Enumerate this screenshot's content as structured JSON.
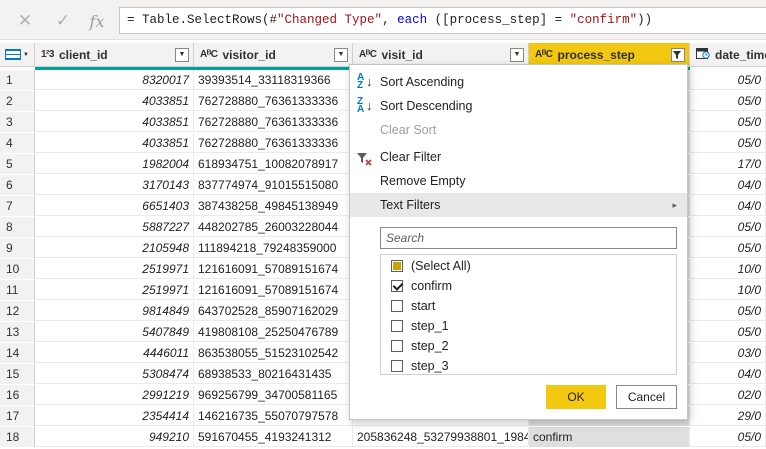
{
  "formula_bar": {
    "cancel_icon": "✕",
    "commit_icon": "✓",
    "fx_label": "fx",
    "formula_pre": "= Table.SelectRows(#",
    "formula_str1": "\"Changed Type\"",
    "formula_mid1": ", ",
    "formula_kw": "each",
    "formula_mid2": " ([process_step] = ",
    "formula_str2": "\"confirm\"",
    "formula_post": "))"
  },
  "columns": [
    {
      "type_icon": "1²3",
      "name": "client_id"
    },
    {
      "type_icon": "AᴮC",
      "name": "visitor_id"
    },
    {
      "type_icon": "AᴮC",
      "name": "visit_id"
    },
    {
      "type_icon": "AᴮC",
      "name": "process_step"
    },
    {
      "type_icon": "📅",
      "name": "date_time"
    }
  ],
  "rows": [
    {
      "n": "1",
      "client_id": "8320017",
      "visitor_id": "39393514_33118319366",
      "visit_id": "",
      "process_step": "",
      "date_time": "05/0"
    },
    {
      "n": "2",
      "client_id": "4033851",
      "visitor_id": "762728880_76361333336",
      "visit_id": "",
      "process_step": "",
      "date_time": "05/0"
    },
    {
      "n": "3",
      "client_id": "4033851",
      "visitor_id": "762728880_76361333336",
      "visit_id": "",
      "process_step": "",
      "date_time": "05/0"
    },
    {
      "n": "4",
      "client_id": "4033851",
      "visitor_id": "762728880_76361333336",
      "visit_id": "",
      "process_step": "",
      "date_time": "05/0"
    },
    {
      "n": "5",
      "client_id": "1982004",
      "visitor_id": "618934751_10082078917",
      "visit_id": "",
      "process_step": "",
      "date_time": "17/0"
    },
    {
      "n": "6",
      "client_id": "3170143",
      "visitor_id": "837774974_91015515080",
      "visit_id": "",
      "process_step": "",
      "date_time": "04/0"
    },
    {
      "n": "7",
      "client_id": "6651403",
      "visitor_id": "387438258_49845138949",
      "visit_id": "",
      "process_step": "",
      "date_time": "04/0"
    },
    {
      "n": "8",
      "client_id": "5887227",
      "visitor_id": "448202785_26003228044",
      "visit_id": "",
      "process_step": "",
      "date_time": "05/0"
    },
    {
      "n": "9",
      "client_id": "2105948",
      "visitor_id": "111894218_79248359000",
      "visit_id": "",
      "process_step": "",
      "date_time": "05/0"
    },
    {
      "n": "10",
      "client_id": "2519971",
      "visitor_id": "121616091_57089151674",
      "visit_id": "",
      "process_step": "",
      "date_time": "10/0"
    },
    {
      "n": "11",
      "client_id": "2519971",
      "visitor_id": "121616091_57089151674",
      "visit_id": "",
      "process_step": "",
      "date_time": "10/0"
    },
    {
      "n": "12",
      "client_id": "9814849",
      "visitor_id": "643702528_85907162029",
      "visit_id": "",
      "process_step": "",
      "date_time": "05/0"
    },
    {
      "n": "13",
      "client_id": "5407849",
      "visitor_id": "419808108_25250476789",
      "visit_id": "",
      "process_step": "",
      "date_time": "05/0"
    },
    {
      "n": "14",
      "client_id": "4446011",
      "visitor_id": "863538055_51523102542",
      "visit_id": "",
      "process_step": "",
      "date_time": "03/0"
    },
    {
      "n": "15",
      "client_id": "5308474",
      "visitor_id": "68938533_80216431435",
      "visit_id": "",
      "process_step": "",
      "date_time": "04/0"
    },
    {
      "n": "16",
      "client_id": "2991219",
      "visitor_id": "969256799_34700581165",
      "visit_id": "",
      "process_step": "",
      "date_time": "02/0"
    },
    {
      "n": "17",
      "client_id": "2354414",
      "visitor_id": "146216735_55070797578",
      "visit_id": "",
      "process_step": "confirm",
      "date_time": "29/0"
    },
    {
      "n": "18",
      "client_id": "949210",
      "visitor_id": "591670455_4193241312",
      "visit_id": "205836248_53279938801_1984...",
      "process_step": "confirm",
      "date_time": "05/0"
    }
  ],
  "menu": {
    "sort_asc": "Sort Ascending",
    "sort_desc": "Sort Descending",
    "clear_sort": "Clear Sort",
    "clear_filter": "Clear Filter",
    "remove_empty": "Remove Empty",
    "text_filters": "Text Filters",
    "search_placeholder": "Search",
    "values": [
      {
        "label": "(Select All)",
        "state": "partial"
      },
      {
        "label": "confirm",
        "state": "checked"
      },
      {
        "label": "start",
        "state": "unchecked"
      },
      {
        "label": "step_1",
        "state": "unchecked"
      },
      {
        "label": "step_2",
        "state": "unchecked"
      },
      {
        "label": "step_3",
        "state": "unchecked"
      }
    ],
    "ok": "OK",
    "cancel": "Cancel"
  },
  "colors": {
    "accent": "#f2c811",
    "quality": "#00a19a",
    "sort_icon": "#0078d4"
  }
}
